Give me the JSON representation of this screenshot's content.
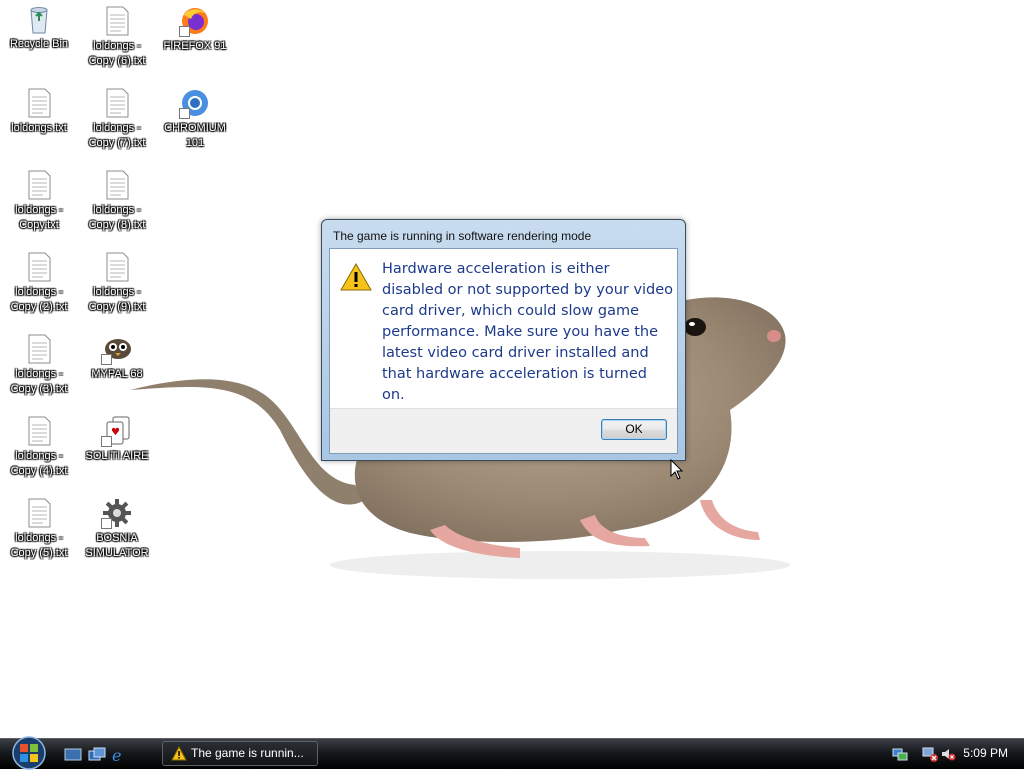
{
  "desktop": {
    "icons": [
      {
        "label": "Recycle Bin"
      },
      {
        "label": "loldongs - Copy (6).txt"
      },
      {
        "label": "FIREFOX 91"
      },
      {
        "label": "loldongs.txt"
      },
      {
        "label": "loldongs - Copy (7).txt"
      },
      {
        "label": "CHROMIUM 101"
      },
      {
        "label": "loldongs - Copy.txt"
      },
      {
        "label": "loldongs - Copy (8).txt"
      },
      {
        "label": "loldongs - Copy (2).txt"
      },
      {
        "label": "loldongs - Copy (9).txt"
      },
      {
        "label": "loldongs - Copy (3).txt"
      },
      {
        "label": "MYPAL 68"
      },
      {
        "label": "loldongs - Copy (4).txt"
      },
      {
        "label": "SOLITI AIRE"
      },
      {
        "label": "loldongs - Copy (5).txt"
      },
      {
        "label": "BOSNIA SIMULATOR"
      }
    ]
  },
  "dialog": {
    "title": "The game is running in software rendering mode",
    "message": "Hardware acceleration is either disabled or not supported by your video card driver, which could slow game performance. Make sure you have the latest video card driver installed and that hardware acceleration is turned on.",
    "ok_label": "OK",
    "icon": "warning-icon"
  },
  "taskbar": {
    "task_label": "The game is runnin...",
    "clock": "5:09 PM"
  }
}
